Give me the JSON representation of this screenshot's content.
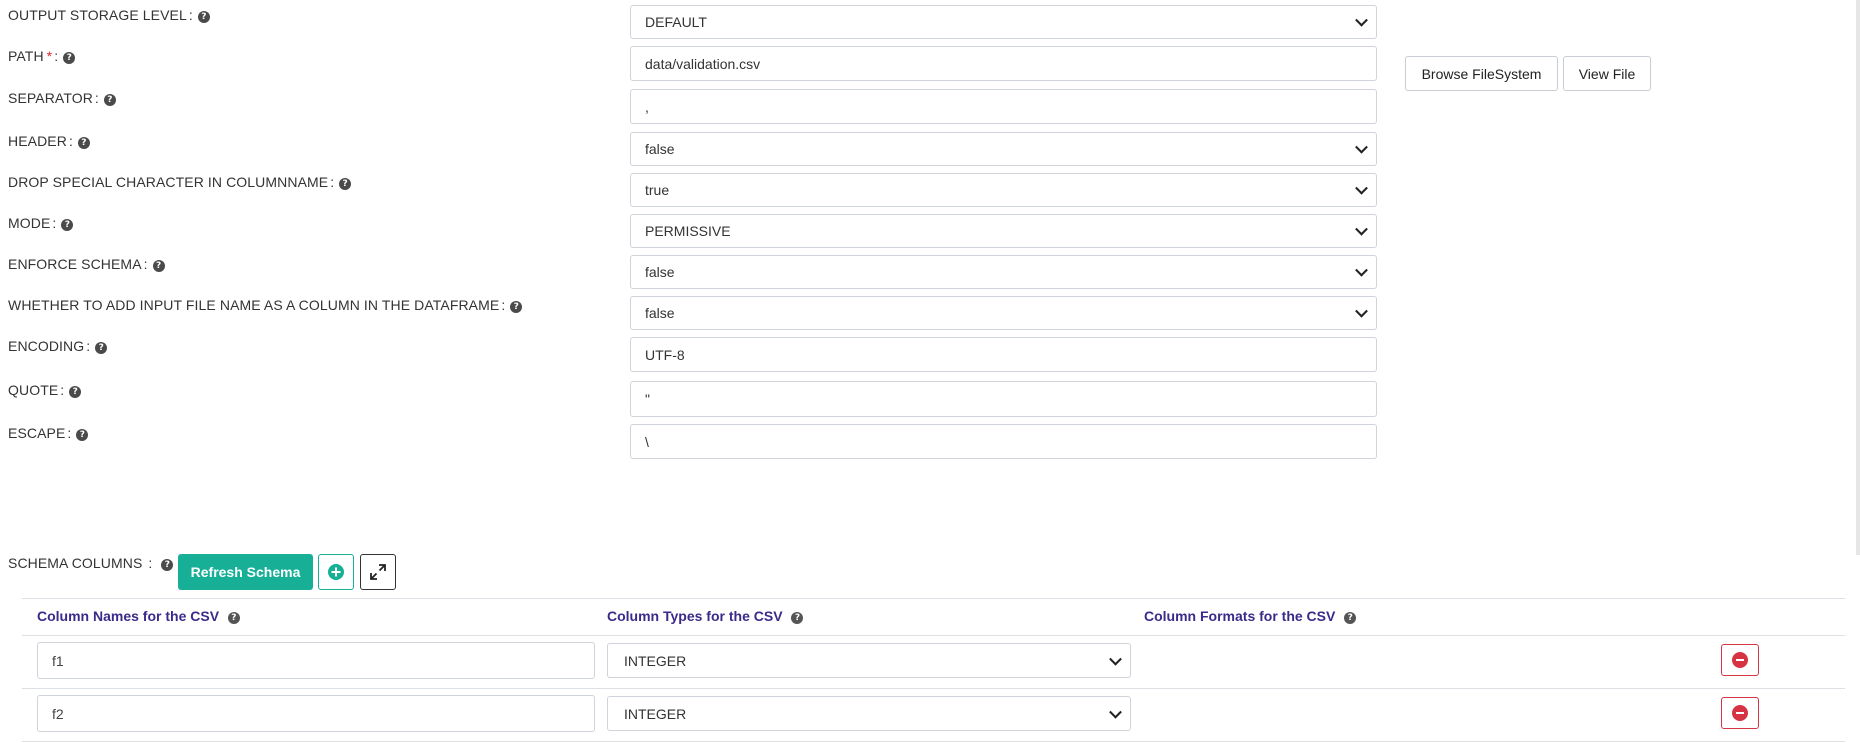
{
  "form": {
    "fields": [
      {
        "label": "OUTPUT STORAGE LEVEL",
        "required": false,
        "type": "select",
        "value": "DEFAULT"
      },
      {
        "label": "PATH",
        "required": true,
        "type": "input",
        "value": "data/validation.csv"
      },
      {
        "label": "SEPARATOR",
        "required": false,
        "type": "input",
        "value": ","
      },
      {
        "label": "HEADER",
        "required": false,
        "type": "select",
        "value": "false"
      },
      {
        "label": "DROP SPECIAL CHARACTER IN COLUMNNAME",
        "required": false,
        "type": "select",
        "value": "true"
      },
      {
        "label": "MODE",
        "required": false,
        "type": "select",
        "value": "PERMISSIVE"
      },
      {
        "label": "ENFORCE SCHEMA",
        "required": false,
        "type": "select",
        "value": "false"
      },
      {
        "label": "WHETHER TO ADD INPUT FILE NAME AS A COLUMN IN THE DATAFRAME",
        "required": false,
        "type": "select",
        "value": "false"
      },
      {
        "label": "ENCODING",
        "required": false,
        "type": "input",
        "value": "UTF-8"
      },
      {
        "label": "QUOTE",
        "required": false,
        "type": "input",
        "value": "\""
      },
      {
        "label": "ESCAPE",
        "required": false,
        "type": "input",
        "value": "\\"
      }
    ],
    "colon": ":",
    "required_mark": "*",
    "help_icon": "question-circle-icon"
  },
  "path_actions": {
    "browse_label": "Browse FileSystem",
    "view_label": "View File"
  },
  "schema": {
    "label": "SCHEMA COLUMNS",
    "refresh_label": "Refresh Schema",
    "add_icon": "plus-circle-icon",
    "expand_icon": "expand-icon",
    "columns": {
      "names": "Column Names for the CSV",
      "types": "Column Types for the CSV",
      "formats": "Column Formats for the CSV"
    },
    "rows": [
      {
        "name": "f1",
        "type": "INTEGER",
        "format": ""
      },
      {
        "name": "f2",
        "type": "INTEGER",
        "format": ""
      }
    ],
    "delete_icon": "minus-circle-icon"
  },
  "colors": {
    "teal": "#17b097",
    "header_purple": "#3c2a8a",
    "danger": "#d63343",
    "required": "#e02424"
  }
}
